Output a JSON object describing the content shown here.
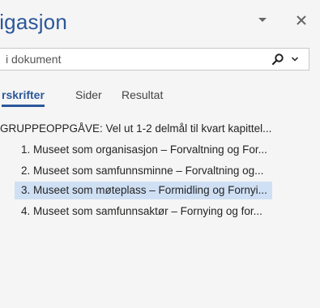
{
  "pane": {
    "title": "vigasjon",
    "dropdown_glyph": "▾",
    "close_glyph": "✕"
  },
  "search": {
    "placeholder": "i dokument"
  },
  "tabs": [
    {
      "label": "rskrifter",
      "active": true
    },
    {
      "label": "Sider",
      "active": false
    },
    {
      "label": "Resultat",
      "active": false
    }
  ],
  "headings": [
    {
      "text": "GRUPPEOPPGÅVE: Vel ut 1-2 delmål til kvart kapittel...",
      "level": 1,
      "selected": false
    },
    {
      "text": "1. Museet som organisasjon – Forvaltning og For...",
      "level": 2,
      "selected": false
    },
    {
      "text": "2. Museet som samfunnsminne – Forvaltning og...",
      "level": 2,
      "selected": false
    },
    {
      "text": "3. Museet som møteplass – Formidling og Fornyi...",
      "level": 2,
      "selected": true
    },
    {
      "text": "4. Museet som samfunnsaktør – Fornying og for...",
      "level": 2,
      "selected": false
    }
  ],
  "colors": {
    "accent": "#2b579a",
    "selection": "#cfe0f5",
    "background": "#f5f5f5"
  },
  "icons": {
    "search": "search-icon",
    "search_options": "chevron-down-icon",
    "pane_options": "caret-down-icon",
    "close": "close-icon"
  }
}
